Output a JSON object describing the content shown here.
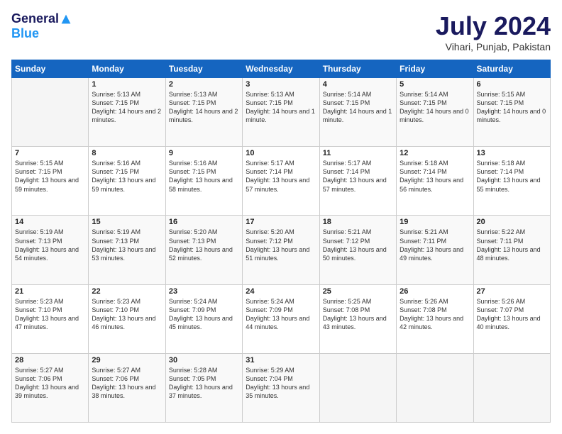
{
  "header": {
    "logo_general": "General",
    "logo_blue": "Blue",
    "month_title": "July 2024",
    "location": "Vihari, Punjab, Pakistan"
  },
  "days_of_week": [
    "Sunday",
    "Monday",
    "Tuesday",
    "Wednesday",
    "Thursday",
    "Friday",
    "Saturday"
  ],
  "weeks": [
    [
      {
        "day": "",
        "sunrise": "",
        "sunset": "",
        "daylight": ""
      },
      {
        "day": "1",
        "sunrise": "Sunrise: 5:13 AM",
        "sunset": "Sunset: 7:15 PM",
        "daylight": "Daylight: 14 hours and 2 minutes."
      },
      {
        "day": "2",
        "sunrise": "Sunrise: 5:13 AM",
        "sunset": "Sunset: 7:15 PM",
        "daylight": "Daylight: 14 hours and 2 minutes."
      },
      {
        "day": "3",
        "sunrise": "Sunrise: 5:13 AM",
        "sunset": "Sunset: 7:15 PM",
        "daylight": "Daylight: 14 hours and 1 minute."
      },
      {
        "day": "4",
        "sunrise": "Sunrise: 5:14 AM",
        "sunset": "Sunset: 7:15 PM",
        "daylight": "Daylight: 14 hours and 1 minute."
      },
      {
        "day": "5",
        "sunrise": "Sunrise: 5:14 AM",
        "sunset": "Sunset: 7:15 PM",
        "daylight": "Daylight: 14 hours and 0 minutes."
      },
      {
        "day": "6",
        "sunrise": "Sunrise: 5:15 AM",
        "sunset": "Sunset: 7:15 PM",
        "daylight": "Daylight: 14 hours and 0 minutes."
      }
    ],
    [
      {
        "day": "7",
        "sunrise": "Sunrise: 5:15 AM",
        "sunset": "Sunset: 7:15 PM",
        "daylight": "Daylight: 13 hours and 59 minutes."
      },
      {
        "day": "8",
        "sunrise": "Sunrise: 5:16 AM",
        "sunset": "Sunset: 7:15 PM",
        "daylight": "Daylight: 13 hours and 59 minutes."
      },
      {
        "day": "9",
        "sunrise": "Sunrise: 5:16 AM",
        "sunset": "Sunset: 7:15 PM",
        "daylight": "Daylight: 13 hours and 58 minutes."
      },
      {
        "day": "10",
        "sunrise": "Sunrise: 5:17 AM",
        "sunset": "Sunset: 7:14 PM",
        "daylight": "Daylight: 13 hours and 57 minutes."
      },
      {
        "day": "11",
        "sunrise": "Sunrise: 5:17 AM",
        "sunset": "Sunset: 7:14 PM",
        "daylight": "Daylight: 13 hours and 57 minutes."
      },
      {
        "day": "12",
        "sunrise": "Sunrise: 5:18 AM",
        "sunset": "Sunset: 7:14 PM",
        "daylight": "Daylight: 13 hours and 56 minutes."
      },
      {
        "day": "13",
        "sunrise": "Sunrise: 5:18 AM",
        "sunset": "Sunset: 7:14 PM",
        "daylight": "Daylight: 13 hours and 55 minutes."
      }
    ],
    [
      {
        "day": "14",
        "sunrise": "Sunrise: 5:19 AM",
        "sunset": "Sunset: 7:13 PM",
        "daylight": "Daylight: 13 hours and 54 minutes."
      },
      {
        "day": "15",
        "sunrise": "Sunrise: 5:19 AM",
        "sunset": "Sunset: 7:13 PM",
        "daylight": "Daylight: 13 hours and 53 minutes."
      },
      {
        "day": "16",
        "sunrise": "Sunrise: 5:20 AM",
        "sunset": "Sunset: 7:13 PM",
        "daylight": "Daylight: 13 hours and 52 minutes."
      },
      {
        "day": "17",
        "sunrise": "Sunrise: 5:20 AM",
        "sunset": "Sunset: 7:12 PM",
        "daylight": "Daylight: 13 hours and 51 minutes."
      },
      {
        "day": "18",
        "sunrise": "Sunrise: 5:21 AM",
        "sunset": "Sunset: 7:12 PM",
        "daylight": "Daylight: 13 hours and 50 minutes."
      },
      {
        "day": "19",
        "sunrise": "Sunrise: 5:21 AM",
        "sunset": "Sunset: 7:11 PM",
        "daylight": "Daylight: 13 hours and 49 minutes."
      },
      {
        "day": "20",
        "sunrise": "Sunrise: 5:22 AM",
        "sunset": "Sunset: 7:11 PM",
        "daylight": "Daylight: 13 hours and 48 minutes."
      }
    ],
    [
      {
        "day": "21",
        "sunrise": "Sunrise: 5:23 AM",
        "sunset": "Sunset: 7:10 PM",
        "daylight": "Daylight: 13 hours and 47 minutes."
      },
      {
        "day": "22",
        "sunrise": "Sunrise: 5:23 AM",
        "sunset": "Sunset: 7:10 PM",
        "daylight": "Daylight: 13 hours and 46 minutes."
      },
      {
        "day": "23",
        "sunrise": "Sunrise: 5:24 AM",
        "sunset": "Sunset: 7:09 PM",
        "daylight": "Daylight: 13 hours and 45 minutes."
      },
      {
        "day": "24",
        "sunrise": "Sunrise: 5:24 AM",
        "sunset": "Sunset: 7:09 PM",
        "daylight": "Daylight: 13 hours and 44 minutes."
      },
      {
        "day": "25",
        "sunrise": "Sunrise: 5:25 AM",
        "sunset": "Sunset: 7:08 PM",
        "daylight": "Daylight: 13 hours and 43 minutes."
      },
      {
        "day": "26",
        "sunrise": "Sunrise: 5:26 AM",
        "sunset": "Sunset: 7:08 PM",
        "daylight": "Daylight: 13 hours and 42 minutes."
      },
      {
        "day": "27",
        "sunrise": "Sunrise: 5:26 AM",
        "sunset": "Sunset: 7:07 PM",
        "daylight": "Daylight: 13 hours and 40 minutes."
      }
    ],
    [
      {
        "day": "28",
        "sunrise": "Sunrise: 5:27 AM",
        "sunset": "Sunset: 7:06 PM",
        "daylight": "Daylight: 13 hours and 39 minutes."
      },
      {
        "day": "29",
        "sunrise": "Sunrise: 5:27 AM",
        "sunset": "Sunset: 7:06 PM",
        "daylight": "Daylight: 13 hours and 38 minutes."
      },
      {
        "day": "30",
        "sunrise": "Sunrise: 5:28 AM",
        "sunset": "Sunset: 7:05 PM",
        "daylight": "Daylight: 13 hours and 37 minutes."
      },
      {
        "day": "31",
        "sunrise": "Sunrise: 5:29 AM",
        "sunset": "Sunset: 7:04 PM",
        "daylight": "Daylight: 13 hours and 35 minutes."
      },
      {
        "day": "",
        "sunrise": "",
        "sunset": "",
        "daylight": ""
      },
      {
        "day": "",
        "sunrise": "",
        "sunset": "",
        "daylight": ""
      },
      {
        "day": "",
        "sunrise": "",
        "sunset": "",
        "daylight": ""
      }
    ]
  ]
}
